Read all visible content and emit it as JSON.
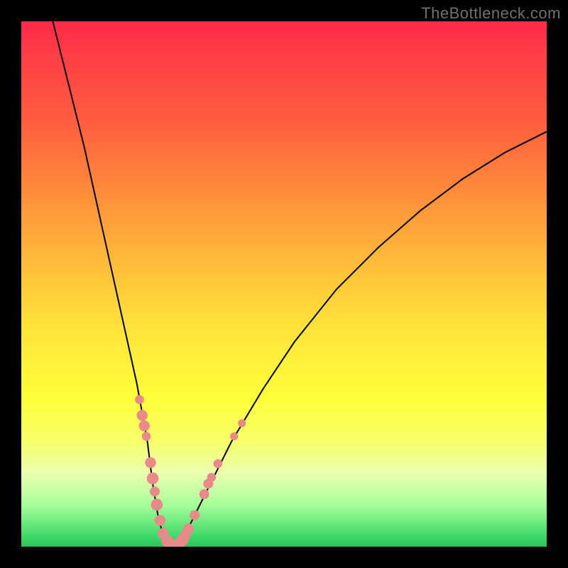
{
  "watermark": "TheBottleneck.com",
  "chart_data": {
    "type": "line",
    "title": "",
    "xlabel": "",
    "ylabel": "",
    "xlim": [
      0,
      100
    ],
    "ylim": [
      0,
      100
    ],
    "series": [
      {
        "name": "curve",
        "x": [
          6,
          8,
          10,
          12,
          14,
          16,
          18,
          20,
          22,
          24,
          25,
          26,
          27,
          28,
          30,
          32,
          36,
          40,
          46,
          52,
          60,
          68,
          76,
          84,
          92,
          100
        ],
        "values": [
          100,
          92,
          84,
          76,
          67,
          58,
          49,
          40,
          31,
          20,
          12,
          6,
          2,
          0,
          0,
          4,
          12,
          20,
          30,
          39,
          49,
          57,
          64,
          70,
          75,
          79
        ]
      }
    ],
    "markers": [
      {
        "x": 22.5,
        "y": 28.0,
        "r": 0.9
      },
      {
        "x": 23.0,
        "y": 25.0,
        "r": 1.1
      },
      {
        "x": 23.4,
        "y": 23.0,
        "r": 1.1
      },
      {
        "x": 23.8,
        "y": 21.0,
        "r": 0.9
      },
      {
        "x": 24.6,
        "y": 16.0,
        "r": 1.1
      },
      {
        "x": 25.0,
        "y": 13.0,
        "r": 1.2
      },
      {
        "x": 25.4,
        "y": 10.5,
        "r": 1.0
      },
      {
        "x": 25.8,
        "y": 8.0,
        "r": 1.2
      },
      {
        "x": 26.4,
        "y": 5.0,
        "r": 1.1
      },
      {
        "x": 27.0,
        "y": 2.5,
        "r": 1.1
      },
      {
        "x": 27.8,
        "y": 1.0,
        "r": 1.2
      },
      {
        "x": 28.5,
        "y": 0.3,
        "r": 1.2
      },
      {
        "x": 29.2,
        "y": 0.2,
        "r": 1.1
      },
      {
        "x": 30.0,
        "y": 0.5,
        "r": 1.2
      },
      {
        "x": 30.6,
        "y": 1.2,
        "r": 1.2
      },
      {
        "x": 31.2,
        "y": 2.2,
        "r": 1.1
      },
      {
        "x": 31.8,
        "y": 3.4,
        "r": 1.1
      },
      {
        "x": 33.0,
        "y": 6.0,
        "r": 1.0
      },
      {
        "x": 34.8,
        "y": 10.0,
        "r": 1.0
      },
      {
        "x": 35.6,
        "y": 12.0,
        "r": 1.0
      },
      {
        "x": 36.2,
        "y": 13.2,
        "r": 0.9
      },
      {
        "x": 37.4,
        "y": 15.8,
        "r": 0.9
      },
      {
        "x": 40.5,
        "y": 21.0,
        "r": 0.8
      },
      {
        "x": 42.0,
        "y": 23.5,
        "r": 0.8
      }
    ]
  }
}
